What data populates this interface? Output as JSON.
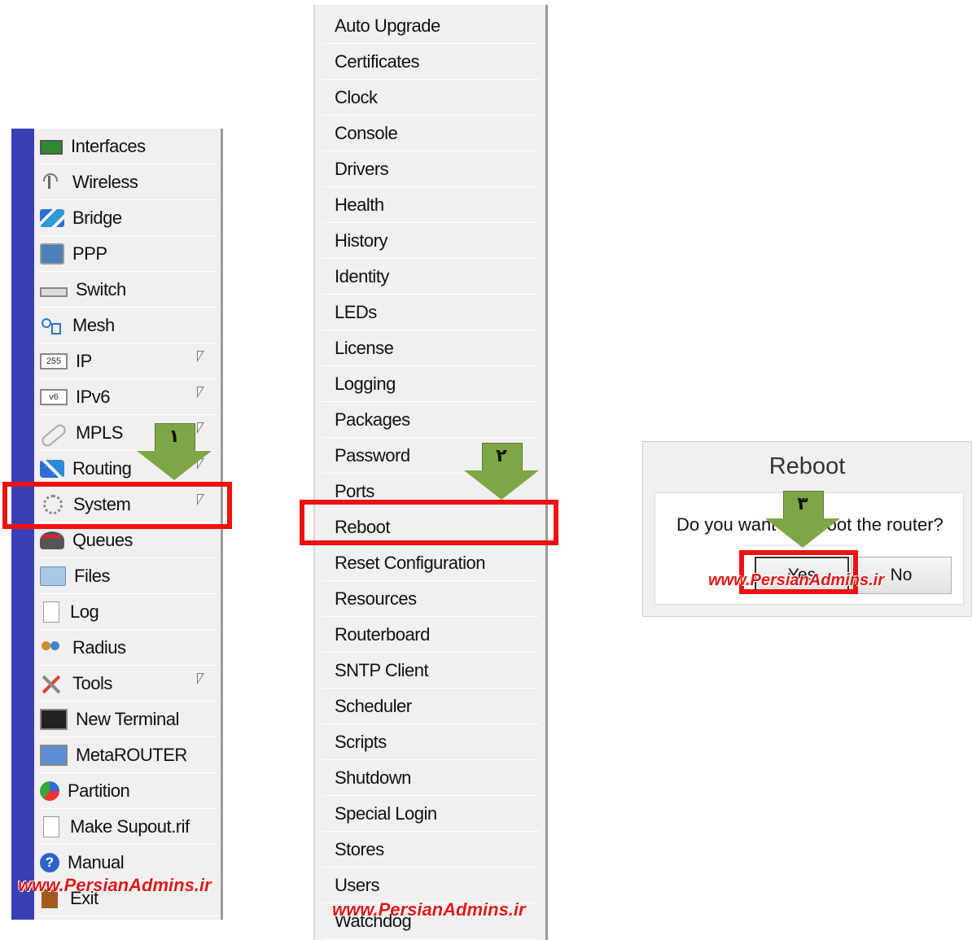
{
  "main_menu": {
    "items": [
      {
        "label": "Interfaces",
        "icon": "interfaces-icon",
        "submenu": false
      },
      {
        "label": "Wireless",
        "icon": "wireless-icon",
        "submenu": false
      },
      {
        "label": "Bridge",
        "icon": "bridge-icon",
        "submenu": false
      },
      {
        "label": "PPP",
        "icon": "ppp-icon",
        "submenu": false
      },
      {
        "label": "Switch",
        "icon": "switch-icon",
        "submenu": false
      },
      {
        "label": "Mesh",
        "icon": "mesh-icon",
        "submenu": false
      },
      {
        "label": "IP",
        "icon": "ip-icon",
        "submenu": true
      },
      {
        "label": "IPv6",
        "icon": "ipv6-icon",
        "submenu": true
      },
      {
        "label": "MPLS",
        "icon": "mpls-icon",
        "submenu": true
      },
      {
        "label": "Routing",
        "icon": "routing-icon",
        "submenu": true
      },
      {
        "label": "System",
        "icon": "system-icon",
        "submenu": true
      },
      {
        "label": "Queues",
        "icon": "queues-icon",
        "submenu": false
      },
      {
        "label": "Files",
        "icon": "files-icon",
        "submenu": false
      },
      {
        "label": "Log",
        "icon": "log-icon",
        "submenu": false
      },
      {
        "label": "Radius",
        "icon": "radius-icon",
        "submenu": false
      },
      {
        "label": "Tools",
        "icon": "tools-icon",
        "submenu": true
      },
      {
        "label": "New Terminal",
        "icon": "terminal-icon",
        "submenu": false
      },
      {
        "label": "MetaROUTER",
        "icon": "metarouter-icon",
        "submenu": false
      },
      {
        "label": "Partition",
        "icon": "partition-icon",
        "submenu": false
      },
      {
        "label": "Make Supout.rif",
        "icon": "supout-icon",
        "submenu": false
      },
      {
        "label": "Manual",
        "icon": "manual-icon",
        "submenu": false
      },
      {
        "label": "Exit",
        "icon": "exit-icon",
        "submenu": false
      }
    ]
  },
  "system_menu": {
    "items": [
      "Auto Upgrade",
      "Certificates",
      "Clock",
      "Console",
      "Drivers",
      "Health",
      "History",
      "Identity",
      "LEDs",
      "License",
      "Logging",
      "Packages",
      "Password",
      "Ports",
      "Reboot",
      "Reset Configuration",
      "Resources",
      "Routerboard",
      "SNTP Client",
      "Scheduler",
      "Scripts",
      "Shutdown",
      "Special Login",
      "Stores",
      "Users",
      "Watchdog"
    ]
  },
  "dialog": {
    "title": "Reboot",
    "message": "Do you want to reboot the router?",
    "yes_label": "Yes",
    "no_label": "No"
  },
  "annotations": {
    "step1": "١",
    "step2": "٢",
    "step3": "٣",
    "watermark": "www.PersianAdmins.ir",
    "highlight_color": "#ee1111",
    "arrow_color": "#7fa646"
  },
  "colors": {
    "menu_stripe": "#3b3fb4",
    "menu_background": "#f0f0f0"
  }
}
